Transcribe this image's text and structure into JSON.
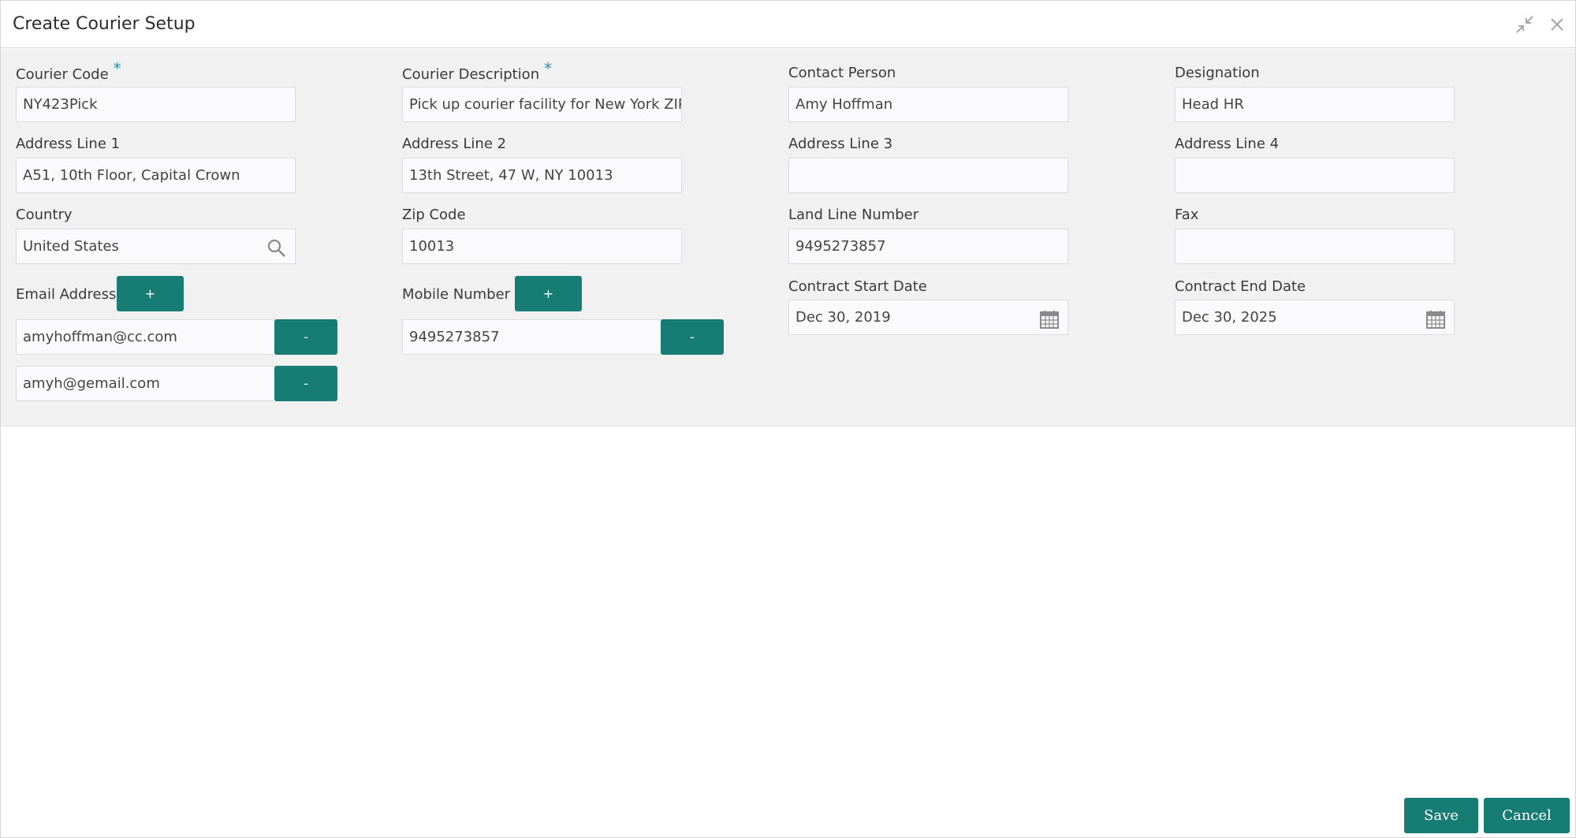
{
  "window": {
    "title": "Create Courier Setup",
    "minimize_icon": "compress-arrows-icon",
    "close_icon": "close-icon"
  },
  "form": {
    "courier_code": {
      "label": "Courier Code",
      "required_mark": "*",
      "value": "NY423Pick"
    },
    "courier_description": {
      "label": "Courier Description",
      "required_mark": "*",
      "value": "Pick up courier facility for New York ZIP"
    },
    "contact_person": {
      "label": "Contact Person",
      "value": "Amy Hoffman"
    },
    "designation": {
      "label": "Designation",
      "value": "Head HR"
    },
    "address_line_1": {
      "label": "Address Line 1",
      "value": "A51, 10th Floor, Capital Crown"
    },
    "address_line_2": {
      "label": "Address Line 2",
      "value": "13th Street, 47 W, NY 10013"
    },
    "address_line_3": {
      "label": "Address Line 3",
      "value": ""
    },
    "address_line_4": {
      "label": "Address Line 4",
      "value": ""
    },
    "country": {
      "label": "Country",
      "value": "United States",
      "icon": "search-icon"
    },
    "zip_code": {
      "label": "Zip Code",
      "value": "10013"
    },
    "land_line_number": {
      "label": "Land Line Number",
      "value": "9495273857"
    },
    "fax": {
      "label": "Fax",
      "value": ""
    },
    "email_address": {
      "label": "Email Address",
      "add_label": "+",
      "remove_label": "-",
      "entries": [
        "amyhoffman@cc.com",
        "amyh@gemail.com"
      ]
    },
    "mobile_number": {
      "label": "Mobile Number",
      "add_label": "+",
      "remove_label": "-",
      "entries": [
        "9495273857"
      ]
    },
    "contract_start_date": {
      "label": "Contract Start Date",
      "value": "Dec 30, 2019",
      "icon": "calendar-icon"
    },
    "contract_end_date": {
      "label": "Contract End Date",
      "value": "Dec 30, 2025",
      "icon": "calendar-icon"
    }
  },
  "footer": {
    "save_label": "Save",
    "cancel_label": "Cancel"
  },
  "colors": {
    "accent": "#177c74",
    "required": "#2e8fb3",
    "form_background": "#f1f1f2"
  }
}
